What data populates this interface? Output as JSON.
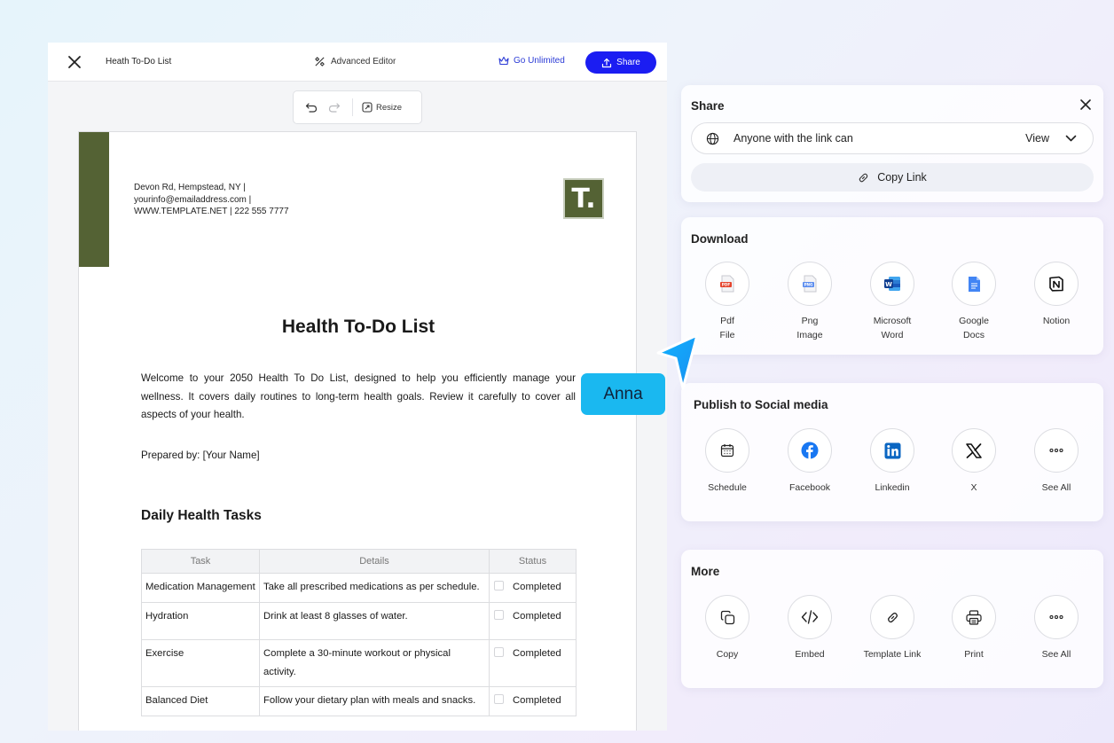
{
  "editor": {
    "doc_title": "Heath To-Do List",
    "advanced_editor": "Advanced Editor",
    "go_unlimited": "Go Unlimited",
    "share": "Share",
    "resize": "Resize"
  },
  "document": {
    "address_line1": "Devon Rd, Hempstead, NY |",
    "address_line2": "yourinfo@emailaddress.com |",
    "address_line3": "WWW.TEMPLATE.NET | 222 555 7777",
    "logo_letter": "T.",
    "title": "Health To-Do List",
    "intro": "Welcome to your 2050 Health To Do List, designed to help you efficiently manage your wellness. It covers daily routines to long-term health goals. Review it carefully to cover all aspects of your health.",
    "prepared_by": "Prepared by: [Your Name]",
    "section_title": "Daily Health Tasks",
    "table": {
      "headers": [
        "Task",
        "Details",
        "Status"
      ],
      "rows": [
        {
          "task": "Medication Management",
          "details": "Take all prescribed medications as per schedule.",
          "status": "Completed"
        },
        {
          "task": "Hydration",
          "details": "Drink at least 8 glasses of water.",
          "status": "Completed"
        },
        {
          "task": "Exercise",
          "details": "Complete a 30-minute workout or physical activity.",
          "status": "Completed"
        },
        {
          "task": "Balanced Diet",
          "details": "Follow your dietary plan with meals and snacks.",
          "status": "Completed"
        }
      ]
    }
  },
  "share_panel": {
    "title": "Share",
    "access_text": "Anyone with the link can",
    "permission": "View",
    "copy_link": "Copy Link"
  },
  "download_panel": {
    "title": "Download",
    "items": [
      {
        "line1": "Pdf",
        "line2": "File",
        "icon": "pdf-file-icon"
      },
      {
        "line1": "Png",
        "line2": "Image",
        "icon": "png-image-icon"
      },
      {
        "line1": "Microsoft",
        "line2": "Word",
        "icon": "word-icon"
      },
      {
        "line1": "Google",
        "line2": "Docs",
        "icon": "google-docs-icon"
      },
      {
        "line1": "Notion",
        "line2": "",
        "icon": "notion-icon"
      }
    ]
  },
  "social_panel": {
    "title": "Publish to Social media",
    "items": [
      {
        "label": "Schedule",
        "icon": "calendar-icon"
      },
      {
        "label": "Facebook",
        "icon": "facebook-icon"
      },
      {
        "label": "Linkedin",
        "icon": "linkedin-icon"
      },
      {
        "label": "X",
        "icon": "x-icon"
      },
      {
        "label": "See All",
        "icon": "more-icon"
      }
    ]
  },
  "more_panel": {
    "title": "More",
    "items": [
      {
        "label": "Copy",
        "icon": "copy-icon"
      },
      {
        "label": "Embed",
        "icon": "code-icon"
      },
      {
        "label": "Template Link",
        "icon": "link-icon"
      },
      {
        "label": "Print",
        "icon": "printer-icon"
      },
      {
        "label": "See All",
        "icon": "more-icon"
      }
    ]
  },
  "collaborator": {
    "name": "Anna"
  },
  "colors": {
    "accent": "#1b1df2",
    "doc_green": "#546234",
    "name_tag": "#1ab8f0"
  }
}
